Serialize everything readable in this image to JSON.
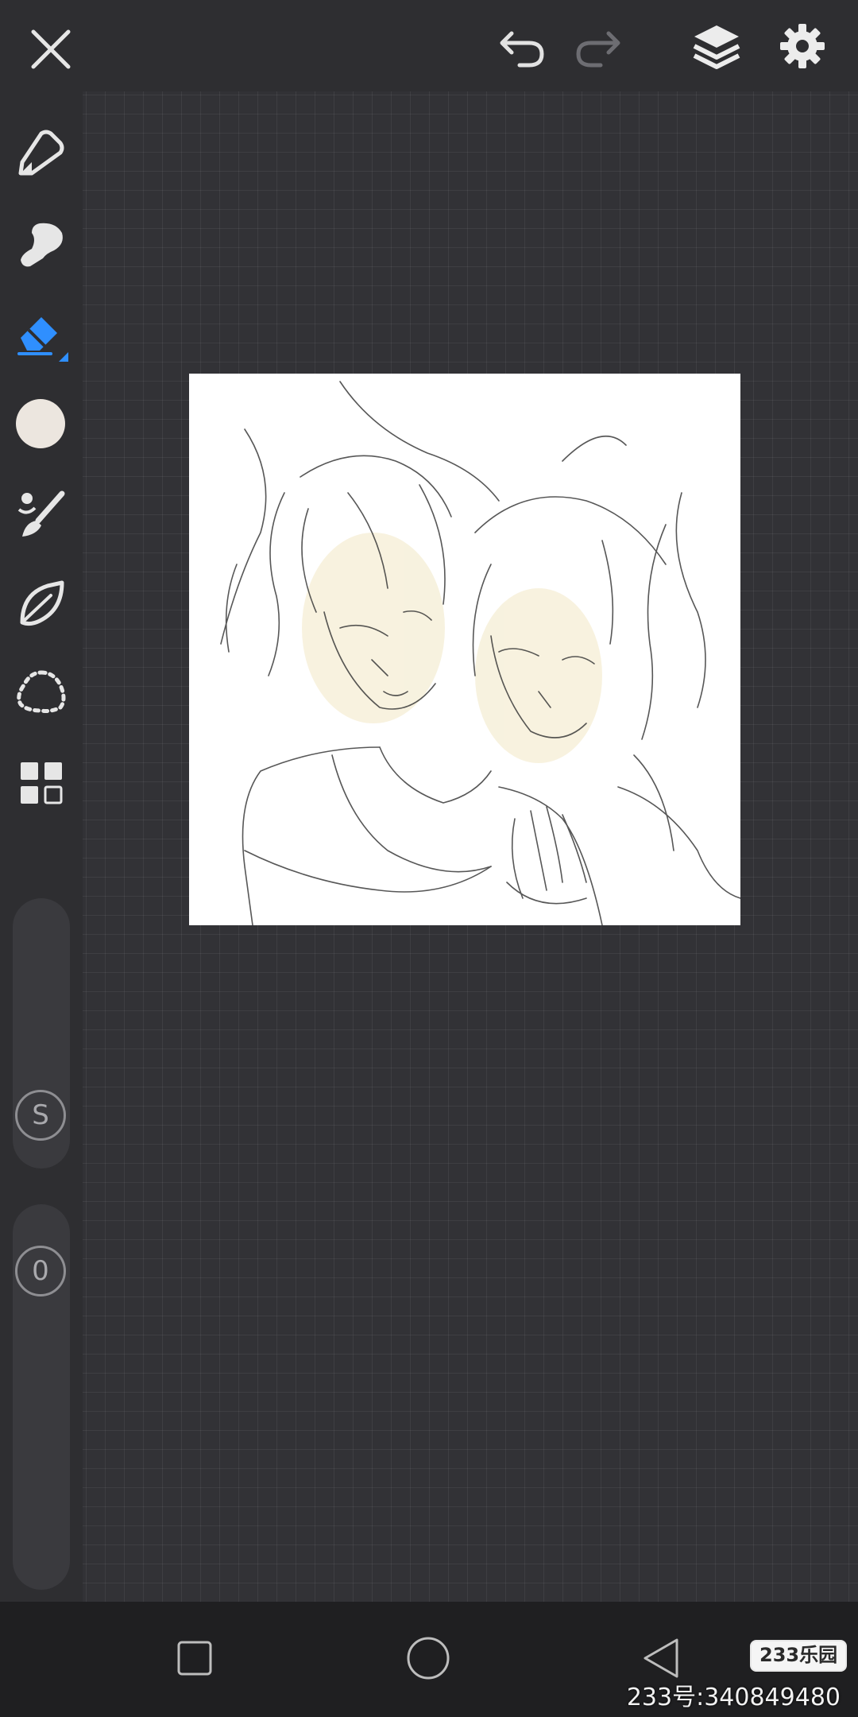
{
  "top_bar": {
    "close_icon": "close-icon",
    "undo_icon": "undo-icon",
    "redo_icon": "redo-icon",
    "layers_icon": "layers-icon",
    "settings_icon": "gear-icon"
  },
  "tools": [
    {
      "name": "pencil",
      "icon": "pencil-icon"
    },
    {
      "name": "smudge",
      "icon": "smudge-icon"
    },
    {
      "name": "eraser",
      "icon": "eraser-icon",
      "selected": true
    },
    {
      "name": "color",
      "icon": "color-swatch",
      "color": "#ece6df"
    },
    {
      "name": "brush",
      "icon": "brush-icon"
    },
    {
      "name": "vector",
      "icon": "leaf-icon"
    },
    {
      "name": "lasso",
      "icon": "lasso-icon"
    },
    {
      "name": "more",
      "icon": "grid-menu-icon"
    }
  ],
  "size_slider": {
    "label": "S"
  },
  "opacity_slider": {
    "label": "0"
  },
  "accent_color": "#2f8fff",
  "navbar": {
    "recent": "square-icon",
    "home": "circle-icon",
    "back": "triangle-back-icon"
  },
  "watermark": {
    "logo": "233乐园",
    "id_text": "233号:340849480"
  }
}
